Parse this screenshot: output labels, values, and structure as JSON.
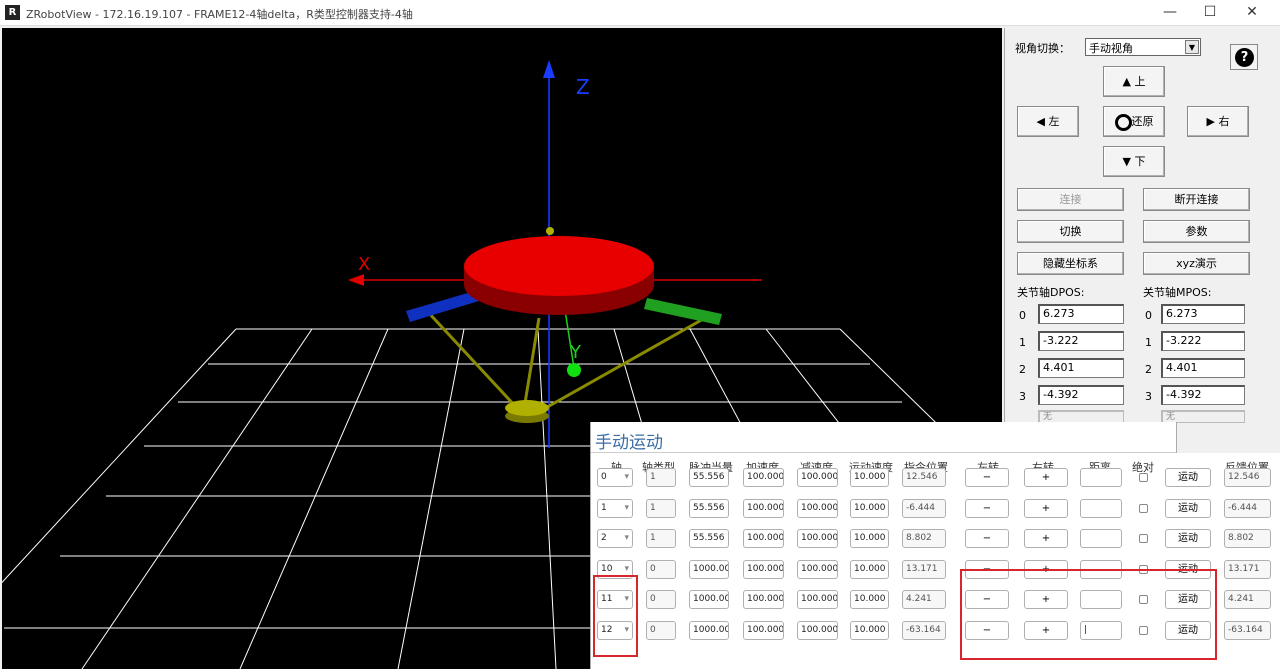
{
  "window": {
    "title": "ZRobotView - 172.16.19.107 - FRAME12-4轴delta，R类型控制器支持-4轴",
    "app_icon": "R",
    "minimize": "—",
    "maximize": "☐",
    "close": "✕"
  },
  "viewport": {
    "axis_z": "Z",
    "axis_x": "X",
    "axis_y": "Y"
  },
  "panel": {
    "view_label": "视角切换：",
    "view_selected": "手动视角",
    "help": "?",
    "up": "上",
    "down": "下",
    "left": "左",
    "right": "右",
    "reset": "还原",
    "connect": "连接",
    "disconnect": "断开连接",
    "switch": "切换",
    "params": "参数",
    "hide_axes": "隐藏坐标系",
    "xyz_demo": "xyz演示",
    "dpos_label": "关节轴DPOS:",
    "mpos_label": "关节轴MPOS:",
    "dpos": [
      {
        "idx": "0",
        "val": "6.273"
      },
      {
        "idx": "1",
        "val": "-3.222"
      },
      {
        "idx": "2",
        "val": "4.401"
      },
      {
        "idx": "3",
        "val": "-4.392"
      }
    ],
    "mpos": [
      {
        "idx": "0",
        "val": "6.273"
      },
      {
        "idx": "1",
        "val": "-3.222"
      },
      {
        "idx": "2",
        "val": "4.401"
      },
      {
        "idx": "3",
        "val": "-4.392"
      }
    ],
    "none_value": "无"
  },
  "jog": {
    "title": "手动运动",
    "headers": [
      "轴",
      "轴类型",
      "脉冲当量",
      "加速度",
      "减速度",
      "运动速度",
      "指令位置",
      "左转",
      "右转",
      "距离",
      "绝对",
      "反馈位置"
    ],
    "minus": "−",
    "plus": "+",
    "move": "运动",
    "rows": [
      {
        "axis": "0",
        "type": "1",
        "units": "55.556",
        "accel": "100.000",
        "decel": "100.000",
        "speed": "10.000",
        "dpos": "12.546",
        "dist": "",
        "fb": "12.546"
      },
      {
        "axis": "1",
        "type": "1",
        "units": "55.556",
        "accel": "100.000",
        "decel": "100.000",
        "speed": "10.000",
        "dpos": "-6.444",
        "dist": "",
        "fb": "-6.444"
      },
      {
        "axis": "2",
        "type": "1",
        "units": "55.556",
        "accel": "100.000",
        "decel": "100.000",
        "speed": "10.000",
        "dpos": "8.802",
        "dist": "",
        "fb": "8.802"
      },
      {
        "axis": "10",
        "type": "0",
        "units": "1000.000",
        "accel": "100.000",
        "decel": "100.000",
        "speed": "10.000",
        "dpos": "13.171",
        "dist": "",
        "fb": "13.171"
      },
      {
        "axis": "11",
        "type": "0",
        "units": "1000.000",
        "accel": "100.000",
        "decel": "100.000",
        "speed": "10.000",
        "dpos": "4.241",
        "dist": "",
        "fb": "4.241"
      },
      {
        "axis": "12",
        "type": "0",
        "units": "1000.000",
        "accel": "100.000",
        "decel": "100.000",
        "speed": "10.000",
        "dpos": "-63.164",
        "dist": "|",
        "fb": "-63.164"
      }
    ]
  },
  "colors": {
    "platform": "#d40000",
    "arm_blue": "#1030c0",
    "arm_green": "#20a020",
    "link": "#8a8a00",
    "highlight": "#d9262d"
  }
}
